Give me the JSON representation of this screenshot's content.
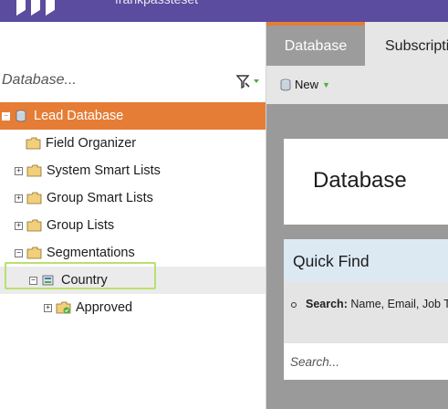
{
  "header": {
    "title": "frankpassteset"
  },
  "left_panel": {
    "search_placeholder": "Database...",
    "tree": [
      {
        "label": "Lead Database",
        "expander": "−",
        "icon": "database-icon",
        "selected": true
      },
      {
        "label": "Field Organizer",
        "expander": "",
        "icon": "folder-icon"
      },
      {
        "label": "System Smart Lists",
        "expander": "+",
        "icon": "folder-icon"
      },
      {
        "label": "Group Smart Lists",
        "expander": "+",
        "icon": "folder-icon"
      },
      {
        "label": "Group Lists",
        "expander": "+",
        "icon": "folder-icon"
      },
      {
        "label": "Segmentations",
        "expander": "−",
        "icon": "folder-icon",
        "highlighted": true
      },
      {
        "label": "Country",
        "expander": "−",
        "icon": "segmentation-icon",
        "hover": true
      },
      {
        "label": "Approved",
        "expander": "+",
        "icon": "segment-approved-icon"
      }
    ]
  },
  "tabs": [
    {
      "label": "Database",
      "active": true
    },
    {
      "label": "Subscriptions",
      "active": false
    }
  ],
  "toolbar": {
    "new_label": "New"
  },
  "main": {
    "card_title": "Database",
    "quick_find": {
      "title": "Quick Find",
      "search_label": "Search:",
      "search_hint": "Name, Email, Job Title",
      "search_placeholder": "Search..."
    }
  },
  "colors": {
    "brand": "#5c4c9f",
    "accent": "#e57d36",
    "highlight": "#b9e070"
  }
}
